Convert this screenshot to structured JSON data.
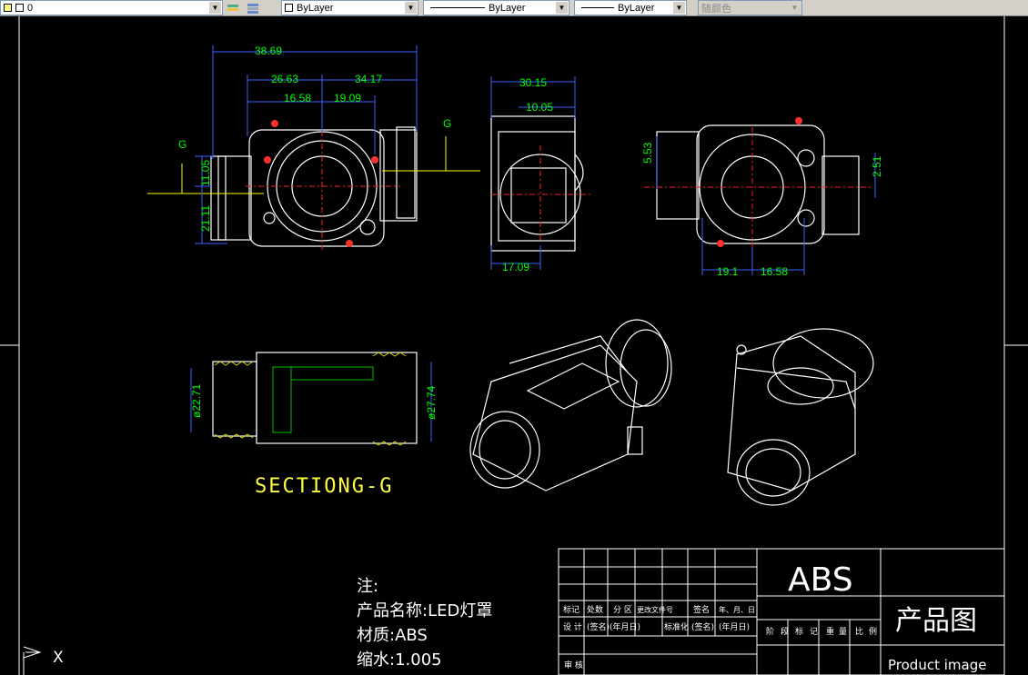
{
  "toolbar": {
    "layer_value": "0",
    "color_value": "ByLayer",
    "linetype_value": "ByLayer",
    "lineweight_value": "ByLayer",
    "plotstyle_value": "随颜色"
  },
  "dimensions": {
    "top_view": [
      "38.69",
      "26.63",
      "34.17",
      "16.58",
      "19.09",
      "11.05",
      "21.11"
    ],
    "side_view": [
      "30.15",
      "10.05",
      "17.09"
    ],
    "right_view": [
      "5.53",
      "2.51",
      "19.1",
      "16.58"
    ],
    "section": [
      "ø22.71",
      "ø27.74"
    ]
  },
  "section_marks": {
    "left": "G",
    "right": "G",
    "title": "SECTIONG-G"
  },
  "notes": {
    "heading": "注:",
    "product_name": "产品名称:LED灯罩",
    "material": "材质:ABS",
    "shrinkage": "缩水:1.005"
  },
  "title_block": {
    "material": "ABS",
    "drawing_title": "产品图",
    "drawing_subtitle": "Product image",
    "row_labels_top": [
      "标记",
      "处数",
      "分 区",
      "更改文件号",
      "签名",
      "年、月、日"
    ],
    "row_labels_mid": [
      "设 计",
      "(签名)",
      "(年月日)",
      "标准化",
      "(签名)",
      "(年月日)"
    ],
    "stage_labels": [
      "阶",
      "段",
      "标",
      "记",
      "重",
      "量",
      "比",
      "例"
    ],
    "bottom_label": "审 核"
  },
  "ucs": {
    "axis_label": "X"
  }
}
